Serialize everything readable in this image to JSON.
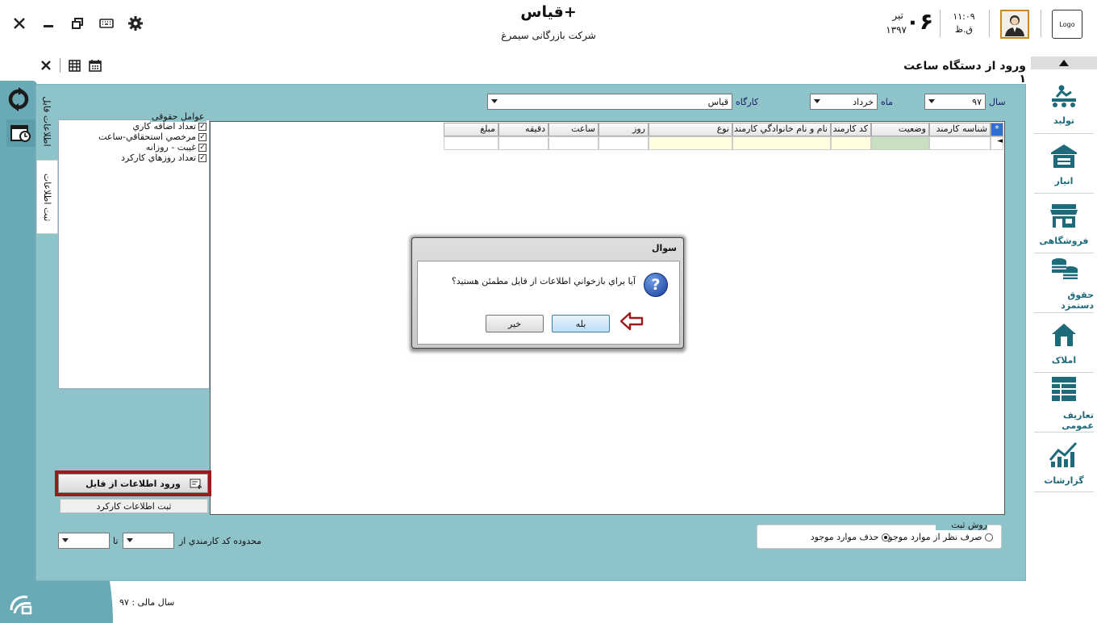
{
  "header": {
    "app_title": "قیاس+",
    "company": "شرکت بازرگانی سیمرغ",
    "date_day": "۰۶",
    "date_month": "تیر",
    "date_year": "۱۳۹۷",
    "time": "۱۱:۰۹",
    "ampm": "ق.ظ",
    "logo_text": "Logo"
  },
  "window_controls": [
    "close-icon",
    "minimize-icon",
    "restore-icon",
    "keyboard-icon",
    "gear-icon"
  ],
  "toolbar": {
    "tools": [
      "close-icon",
      "calculator-icon",
      "calendar-icon"
    ]
  },
  "page": {
    "title": "ورود از دستگاه ساعت ۱"
  },
  "side_tabs": {
    "tab1": "اطلاعات فایل",
    "tab2": "ثبت اطلاعات"
  },
  "filters": {
    "year_label": "سال",
    "year_value": "۹۷",
    "month_label": "ماه",
    "month_value": "خرداد",
    "workshop_label": "کارگاه",
    "workshop_value": "قیاس"
  },
  "factors": {
    "title": "عوامل حقوقی",
    "items": [
      {
        "label": "تعداد اضافه كاري",
        "checked": true
      },
      {
        "label": "مرخصي استحقاقي-ساعت",
        "checked": true
      },
      {
        "label": "غيبت - روزانه",
        "checked": true
      },
      {
        "label": "تعداد روزهاي كاركرد",
        "checked": true
      }
    ]
  },
  "grid": {
    "columns": [
      "شناسه کارمند",
      "وضعیت",
      "کد کارمند",
      "نام و نام خانوادگي کارمند",
      "نوع",
      "روز",
      "ساعت",
      "دقيقه",
      "مبلغ"
    ]
  },
  "buttons": {
    "import_from_file": "ورود اطلاعات از فایل",
    "register_work": "ثبت اطلاعات کارکرد"
  },
  "range": {
    "label": "محدوده کد کارمندي از",
    "to_label": "تا"
  },
  "method": {
    "title": "روش ثبت",
    "option1": "صرف نظر از موارد موجود",
    "option2": "حذف موارد موجود",
    "selected": "option2"
  },
  "footer": {
    "fiscal_year": "سال مالی : ۹۷"
  },
  "nav": [
    {
      "label": "تولید",
      "icon": "production-icon"
    },
    {
      "label": "انبار",
      "icon": "warehouse-icon"
    },
    {
      "label": "فروشگاهی",
      "icon": "store-icon"
    },
    {
      "label": "حقوق دستمزد",
      "icon": "payroll-icon"
    },
    {
      "label": "املاک",
      "icon": "property-icon"
    },
    {
      "label": "تعاریف عمومی",
      "icon": "definitions-icon"
    },
    {
      "label": "گزارشات",
      "icon": "reports-icon"
    }
  ],
  "dialog": {
    "title": "سوال",
    "message": "آيا براي بازخواني اطلاعات از فايل مطمئن هستيد؟",
    "yes": "بله",
    "no": "خير"
  },
  "colors": {
    "panel": "#8fc3ca",
    "accent": "#1d6a7a",
    "highlight_border": "#9b1b1b"
  }
}
